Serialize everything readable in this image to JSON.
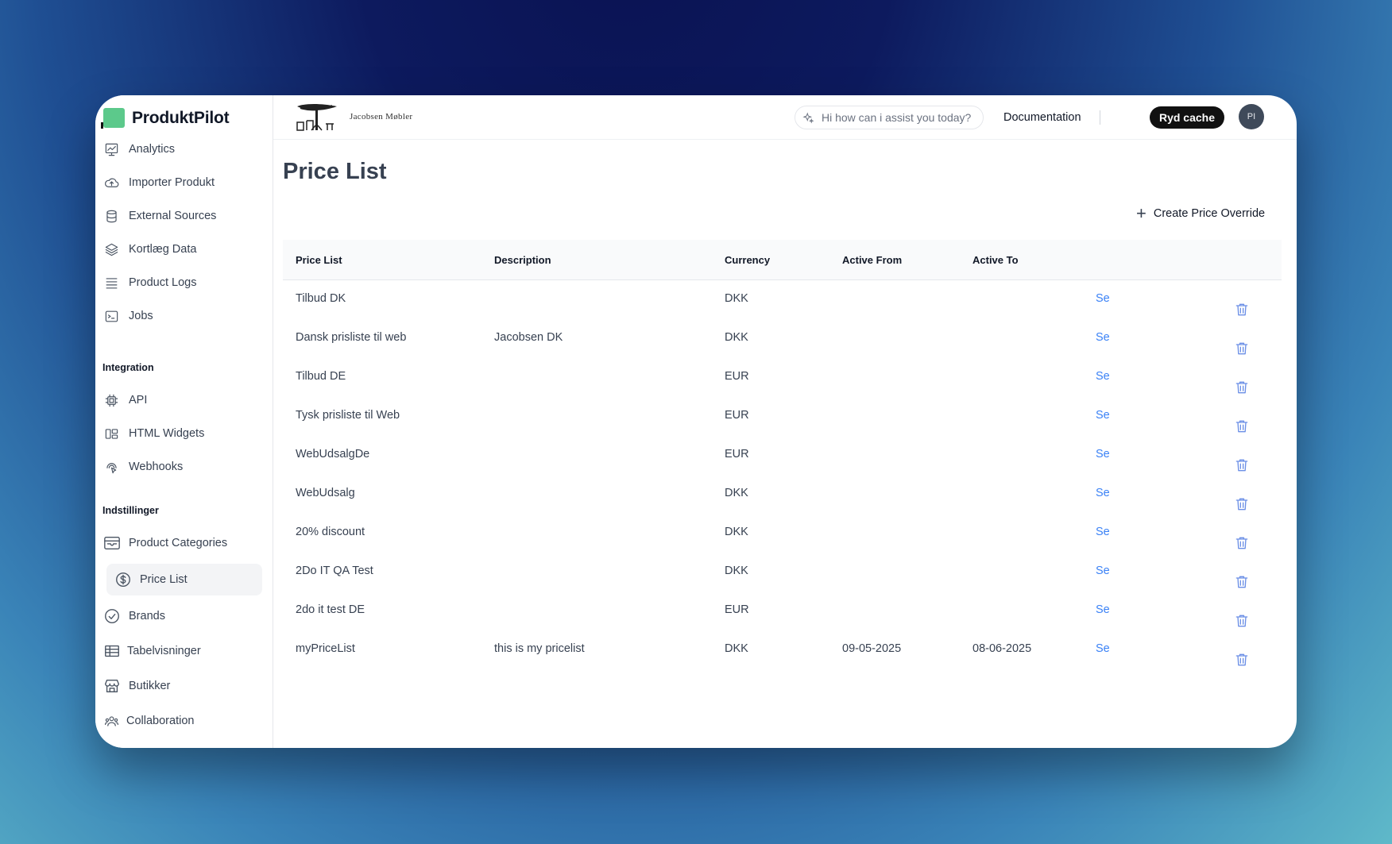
{
  "app": {
    "name": "ProduktPilot"
  },
  "sidebar": {
    "main_items": [
      {
        "label": "Analytics",
        "icon": "chart-icon"
      },
      {
        "label": "Importer Produkt",
        "icon": "cloud-upload-icon"
      },
      {
        "label": "External Sources",
        "icon": "database-icon"
      },
      {
        "label": "Kortlæg Data",
        "icon": "layers-icon"
      },
      {
        "label": "Product Logs",
        "icon": "list-icon"
      },
      {
        "label": "Jobs",
        "icon": "terminal-icon"
      }
    ],
    "integration": {
      "title": "Integration",
      "items": [
        {
          "label": "API",
          "icon": "cpu-icon"
        },
        {
          "label": "HTML Widgets",
          "icon": "widgets-icon"
        },
        {
          "label": "Webhooks",
          "icon": "webhook-icon"
        }
      ]
    },
    "settings": {
      "title": "Indstillinger",
      "items": [
        {
          "label": "Product Categories",
          "icon": "tray-icon"
        },
        {
          "label": "Price List",
          "icon": "dollar-circle-icon"
        },
        {
          "label": "Brands",
          "icon": "check-badge-icon"
        },
        {
          "label": "Tabelvisninger",
          "icon": "table-icon"
        },
        {
          "label": "Butikker",
          "icon": "store-icon"
        },
        {
          "label": "Collaboration",
          "icon": "users-icon"
        }
      ]
    }
  },
  "topbar": {
    "client_logo_text": "Jacobsen Møbler",
    "assistant_placeholder": "Hi how can i assist you today?",
    "documentation_label": "Documentation",
    "clear_cache_label": "Ryd cache",
    "avatar_initials": "PI"
  },
  "page": {
    "title": "Price List",
    "create_label": "Create Price Override"
  },
  "table": {
    "headers": [
      "Price List",
      "Description",
      "Currency",
      "Active From",
      "Active To"
    ],
    "action_label": "Se",
    "rows": [
      {
        "name": "Tilbud DK",
        "description": "",
        "currency": "DKK",
        "from": "",
        "to": ""
      },
      {
        "name": "Dansk prisliste til web",
        "description": "Jacobsen DK",
        "currency": "DKK",
        "from": "",
        "to": ""
      },
      {
        "name": "Tilbud DE",
        "description": "",
        "currency": "EUR",
        "from": "",
        "to": ""
      },
      {
        "name": "Tysk prisliste til Web",
        "description": "",
        "currency": "EUR",
        "from": "",
        "to": ""
      },
      {
        "name": "WebUdsalgDe",
        "description": "",
        "currency": "EUR",
        "from": "",
        "to": ""
      },
      {
        "name": "WebUdsalg",
        "description": "",
        "currency": "DKK",
        "from": "",
        "to": ""
      },
      {
        "name": "20% discount",
        "description": "",
        "currency": "DKK",
        "from": "",
        "to": ""
      },
      {
        "name": "2Do IT QA Test",
        "description": "",
        "currency": "DKK",
        "from": "",
        "to": ""
      },
      {
        "name": "2do it test DE",
        "description": "",
        "currency": "EUR",
        "from": "",
        "to": ""
      },
      {
        "name": "myPriceList",
        "description": "this is my pricelist",
        "currency": "DKK",
        "from": "09-05-2025",
        "to": "08-06-2025"
      }
    ]
  },
  "colors": {
    "brand": "#5cc98b",
    "link": "#3b82f6",
    "delete": "#6b8fe6"
  }
}
